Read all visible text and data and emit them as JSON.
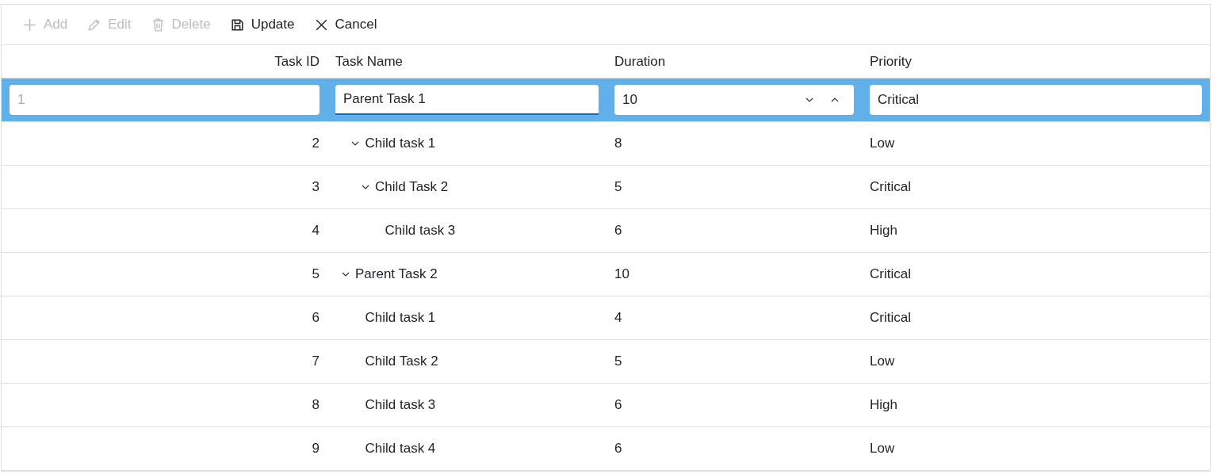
{
  "toolbar": [
    {
      "kind": "add",
      "label": "Add",
      "disabled": true
    },
    {
      "kind": "edit",
      "label": "Edit",
      "disabled": true
    },
    {
      "kind": "delete",
      "label": "Delete",
      "disabled": true
    },
    {
      "kind": "update",
      "label": "Update",
      "disabled": false
    },
    {
      "kind": "cancel",
      "label": "Cancel",
      "disabled": false
    }
  ],
  "columns": [
    "Task ID",
    "Task Name",
    "Duration",
    "Priority"
  ],
  "rows": [
    {
      "task_id": "1",
      "task_name": "Parent Task 1",
      "duration": "10",
      "priority": "Critical",
      "editing": true,
      "id_disabled": true,
      "children": [
        {
          "task_id": "2",
          "task_name": "Child task 1",
          "duration": "8",
          "priority": "Low",
          "editing": false,
          "expanded": true,
          "children": [
            {
              "task_id": "3",
              "task_name": "Child Task 2",
              "duration": "5",
              "priority": "Critical",
              "editing": false,
              "expanded": true,
              "children": [
                {
                  "task_id": "4",
                  "task_name": "Child task 3",
                  "duration": "6",
                  "priority": "High",
                  "editing": false
                }
              ]
            }
          ]
        }
      ]
    },
    {
      "task_id": "5",
      "task_name": "Parent Task 2",
      "duration": "10",
      "priority": "Critical",
      "editing": false,
      "expanded": true,
      "children": [
        {
          "task_id": "6",
          "task_name": "Child task 1",
          "duration": "4",
          "priority": "Critical",
          "editing": false
        },
        {
          "task_id": "7",
          "task_name": "Child Task 2",
          "duration": "5",
          "priority": "Low",
          "editing": false
        },
        {
          "task_id": "8",
          "task_name": "Child task 3",
          "duration": "6",
          "priority": "High",
          "editing": false
        },
        {
          "task_id": "9",
          "task_name": "Child task 4",
          "duration": "6",
          "priority": "Low",
          "editing": false
        }
      ]
    }
  ]
}
